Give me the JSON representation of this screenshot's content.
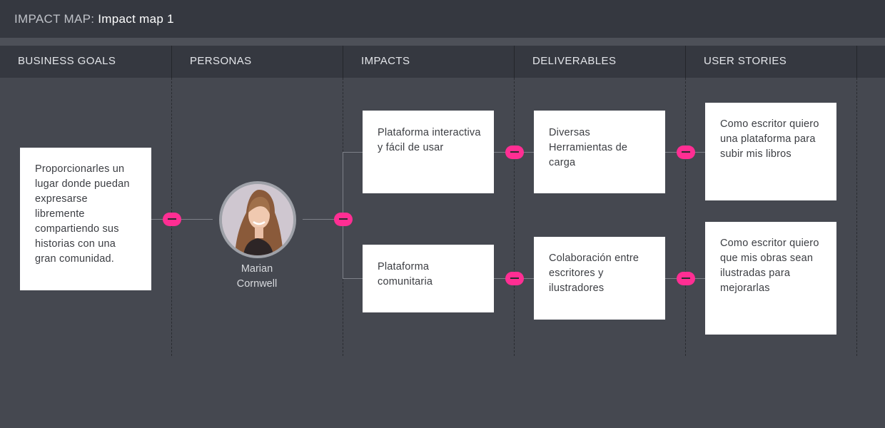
{
  "header": {
    "prefix": "IMPACT MAP:",
    "map_name": "Impact map 1"
  },
  "columns": [
    {
      "label": "BUSINESS GOALS"
    },
    {
      "label": "PERSONAS"
    },
    {
      "label": "IMPACTS"
    },
    {
      "label": "DELIVERABLES"
    },
    {
      "label": "USER STORIES"
    }
  ],
  "business_goal": {
    "text": "Proporcionarles un lugar donde puedan expresarse libremente compartiendo sus historias con una gran comunidad."
  },
  "persona": {
    "name_line1": "Marian",
    "name_line2": "Cornwell"
  },
  "impacts": [
    {
      "text": "Plataforma interactiva y fácil de usar"
    },
    {
      "text": "Plataforma comunitaria"
    }
  ],
  "deliverables": [
    {
      "text": "Diversas Herramientas de carga"
    },
    {
      "text": "Colaboración entre escritores y ilustradores"
    }
  ],
  "user_stories": [
    {
      "text": "Como escritor quiero una plataforma para subir mis libros"
    },
    {
      "text": "Como escritor quiero que mis obras sean ilustradas para mejorarlas"
    }
  ],
  "colors": {
    "background": "#454850",
    "header": "#353840",
    "accent_toggle": "#ff2e93",
    "card": "#ffffff",
    "connector": "#7d8088"
  },
  "icons": {
    "toggle": "collapse-minus-icon",
    "avatar": "persona-avatar"
  }
}
